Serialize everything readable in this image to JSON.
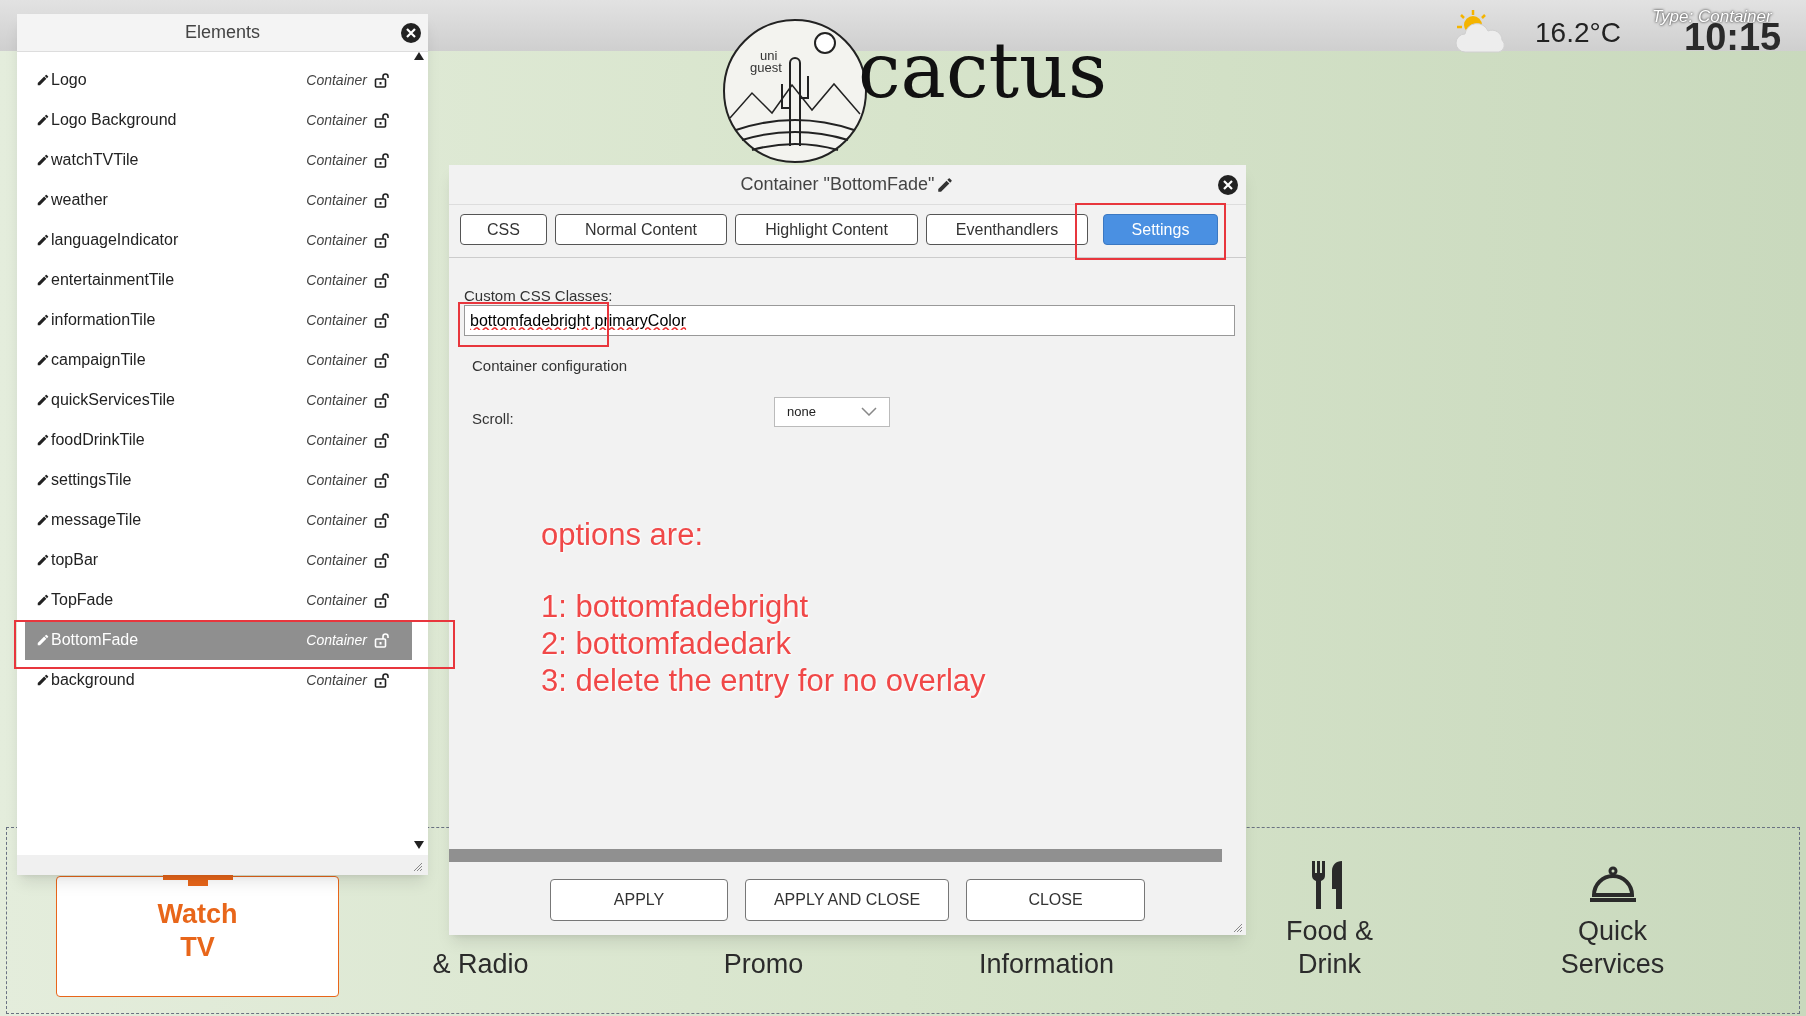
{
  "top_bar": {
    "temperature": "16.2°C",
    "type_label": "Type: Container",
    "time": "10:15"
  },
  "logo": {
    "small_text": [
      "uni",
      "guest"
    ],
    "wordmark": "cactus"
  },
  "tiles": [
    {
      "lines": [
        "Watch",
        "TV"
      ],
      "selected": true,
      "kind": "tv"
    },
    {
      "lines": [
        "& Radio"
      ],
      "selected": false
    },
    {
      "lines": [
        "Promo"
      ],
      "selected": false
    },
    {
      "lines": [
        "Information"
      ],
      "selected": false
    },
    {
      "lines": [
        "Food &",
        "Drink"
      ],
      "selected": false,
      "kind": "cutlery"
    },
    {
      "lines": [
        "Quick",
        "Services"
      ],
      "selected": false,
      "kind": "cloche"
    }
  ],
  "elements_panel": {
    "title": "Elements",
    "items": [
      {
        "name": "Logo",
        "type": "Container",
        "selected": false
      },
      {
        "name": "Logo Background",
        "type": "Container",
        "selected": false
      },
      {
        "name": "watchTVTile",
        "type": "Container",
        "selected": false
      },
      {
        "name": "weather",
        "type": "Container",
        "selected": false
      },
      {
        "name": "languageIndicator",
        "type": "Container",
        "selected": false
      },
      {
        "name": "entertainmentTile",
        "type": "Container",
        "selected": false
      },
      {
        "name": "informationTile",
        "type": "Container",
        "selected": false
      },
      {
        "name": "campaignTile",
        "type": "Container",
        "selected": false
      },
      {
        "name": "quickServicesTile",
        "type": "Container",
        "selected": false
      },
      {
        "name": "foodDrinkTile",
        "type": "Container",
        "selected": false
      },
      {
        "name": "settingsTile",
        "type": "Container",
        "selected": false
      },
      {
        "name": "messageTile",
        "type": "Container",
        "selected": false
      },
      {
        "name": "topBar",
        "type": "Container",
        "selected": false
      },
      {
        "name": "TopFade",
        "type": "Container",
        "selected": false
      },
      {
        "name": "BottomFade",
        "type": "Container",
        "selected": true
      },
      {
        "name": "background",
        "type": "Container",
        "selected": false
      }
    ]
  },
  "dialog": {
    "title": "Container \"BottomFade\"",
    "tabs": [
      {
        "label": "CSS",
        "selected": false
      },
      {
        "label": "Normal Content",
        "selected": false
      },
      {
        "label": "Highlight Content",
        "selected": false
      },
      {
        "label": "Eventhandlers",
        "selected": false
      },
      {
        "label": "Settings",
        "selected": true
      }
    ],
    "custom_css_label": "Custom CSS Classes:",
    "custom_css_value": "bottomfadebright primaryColor",
    "section_label": "Container configuration",
    "scroll_label": "Scroll:",
    "scroll_value": "none",
    "buttons": [
      "APPLY",
      "APPLY AND CLOSE",
      "CLOSE"
    ]
  },
  "annotation": {
    "lines": [
      "options are:",
      "1: bottomfadebright",
      "2: bottomfadedark",
      "3: delete the entry for no overlay"
    ]
  }
}
